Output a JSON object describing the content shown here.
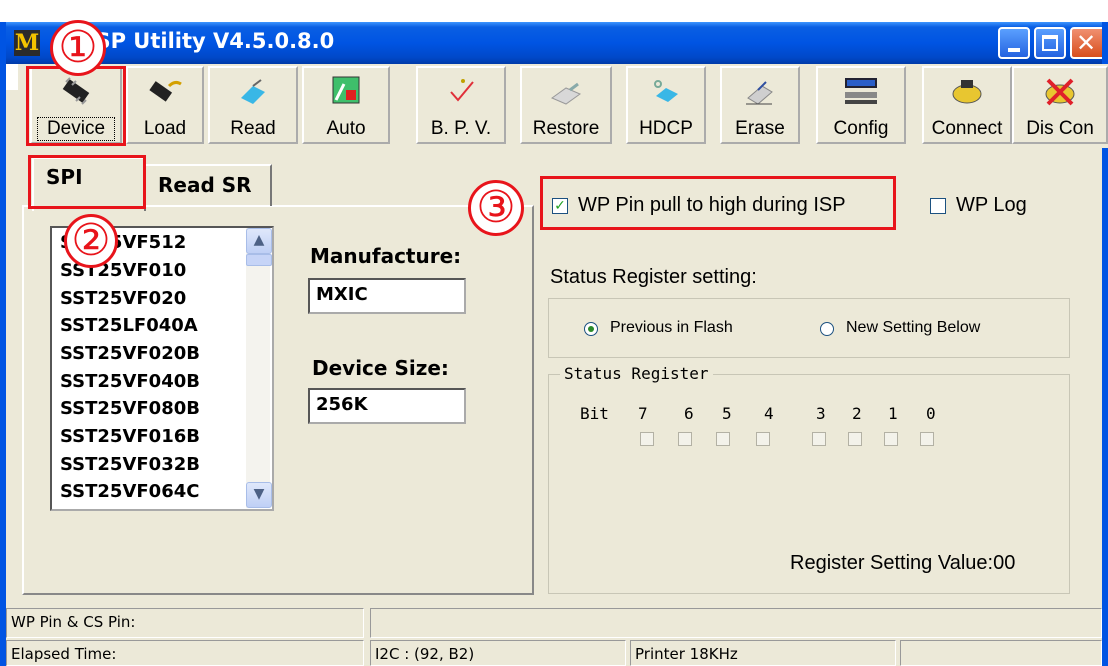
{
  "window": {
    "app_letter": "M",
    "title": "r ISP Utility V4.5.0.8.0",
    "minimize_glyph": "",
    "maximize_glyph": "",
    "close_glyph": "✕"
  },
  "annotations": [
    "①",
    "②",
    "③"
  ],
  "toolbar": {
    "buttons": [
      {
        "label": "Device",
        "icon": "chip-icon"
      },
      {
        "label": "Load",
        "icon": "chip-load-icon"
      },
      {
        "label": "Read",
        "icon": "read-icon"
      },
      {
        "label": "Auto",
        "icon": "auto-icon"
      },
      {
        "label": "B. P. V.",
        "icon": "checkmark-icon"
      },
      {
        "label": "Restore",
        "icon": "restore-icon"
      },
      {
        "label": "HDCP",
        "icon": "hdcp-icon"
      },
      {
        "label": "Erase",
        "icon": "eraser-icon"
      },
      {
        "label": "Config",
        "icon": "computer-icon"
      },
      {
        "label": "Connect",
        "icon": "connect-icon"
      },
      {
        "label": "Dis Con",
        "icon": "disconnect-icon"
      }
    ]
  },
  "tabs": [
    {
      "label": "SPI",
      "active": true
    },
    {
      "label": "Read SR",
      "active": false
    }
  ],
  "device_list": {
    "items": [
      "SST25VF512",
      "SST25VF010",
      "SST25VF020",
      "SST25LF040A",
      "SST25VF020B",
      "SST25VF040B",
      "SST25VF080B",
      "SST25VF016B",
      "SST25VF032B",
      "SST25VF064C"
    ],
    "scroll_up": "▲",
    "scroll_down": "▼"
  },
  "manufacture": {
    "label": "Manufacture:",
    "value": "MXIC"
  },
  "device_size": {
    "label": "Device Size:",
    "value": "256K"
  },
  "wp_pin": {
    "label": "WP Pin pull to high during ISP",
    "checked": true,
    "check_glyph": "✓"
  },
  "wp_log": {
    "label": "WP Log",
    "checked": false
  },
  "status_register_setting": {
    "label": "Status Register setting:",
    "options": [
      {
        "label": "Previous in Flash",
        "selected": true
      },
      {
        "label": "New Setting Below",
        "selected": false
      }
    ]
  },
  "status_register": {
    "title": "Status Register",
    "bit_label": "Bit",
    "bits": [
      "7",
      "6",
      "5",
      "4",
      "3",
      "2",
      "1",
      "0"
    ],
    "value_text": "Register Setting Value:00"
  },
  "status_bar": {
    "wp_cs": "WP Pin & CS Pin:",
    "elapsed": "Elapsed Time:",
    "i2c": "I2C : (92, B2)",
    "printer": "Printer  18KHz"
  },
  "colors": {
    "annotation": "#e8141b",
    "titlebar": "#0054e3",
    "background": "#ece9d8"
  }
}
